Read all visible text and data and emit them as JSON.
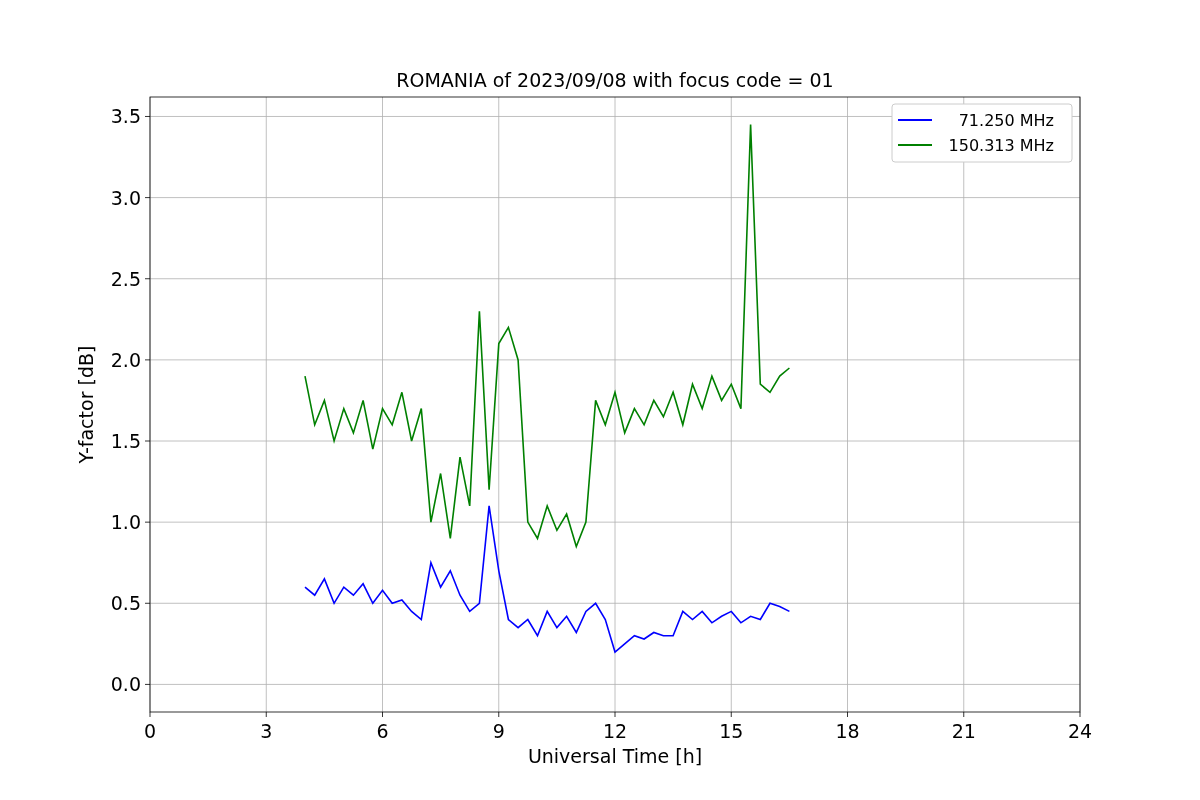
{
  "chart_data": {
    "type": "line",
    "title": "ROMANIA of 2023/09/08 with focus code = 01",
    "xlabel": "Universal Time [h]",
    "ylabel": "Y-factor [dB]",
    "x": [
      4.0,
      4.25,
      4.5,
      4.75,
      5.0,
      5.25,
      5.5,
      5.75,
      6.0,
      6.25,
      6.5,
      6.75,
      7.0,
      7.25,
      7.5,
      7.75,
      8.0,
      8.25,
      8.5,
      8.75,
      9.0,
      9.25,
      9.5,
      9.75,
      10.0,
      10.25,
      10.5,
      10.75,
      11.0,
      11.25,
      11.5,
      11.75,
      12.0,
      12.25,
      12.5,
      12.75,
      13.0,
      13.25,
      13.5,
      13.75,
      14.0,
      14.25,
      14.5,
      14.75,
      15.0,
      15.25,
      15.5,
      15.75,
      16.0,
      16.25,
      16.5
    ],
    "series": [
      {
        "name": "71.250 MHz",
        "color": "#0000ff",
        "values": [
          0.6,
          0.55,
          0.65,
          0.5,
          0.6,
          0.55,
          0.62,
          0.5,
          0.58,
          0.5,
          0.52,
          0.45,
          0.4,
          0.75,
          0.6,
          0.7,
          0.55,
          0.45,
          0.5,
          1.1,
          0.7,
          0.4,
          0.35,
          0.4,
          0.3,
          0.45,
          0.35,
          0.42,
          0.32,
          0.45,
          0.5,
          0.4,
          0.2,
          0.25,
          0.3,
          0.28,
          0.32,
          0.3,
          0.3,
          0.45,
          0.4,
          0.45,
          0.38,
          0.42,
          0.45,
          0.38,
          0.42,
          0.4,
          0.5,
          0.48,
          0.45
        ]
      },
      {
        "name": "150.313 MHz",
        "color": "#008000",
        "values": [
          1.9,
          1.6,
          1.75,
          1.5,
          1.7,
          1.55,
          1.75,
          1.45,
          1.7,
          1.6,
          1.8,
          1.5,
          1.7,
          1.0,
          1.3,
          0.9,
          1.4,
          1.1,
          2.3,
          1.2,
          2.1,
          2.2,
          2.0,
          1.0,
          0.9,
          1.1,
          0.95,
          1.05,
          0.85,
          1.0,
          1.75,
          1.6,
          1.8,
          1.55,
          1.7,
          1.6,
          1.75,
          1.65,
          1.8,
          1.6,
          1.85,
          1.7,
          1.9,
          1.75,
          1.85,
          1.7,
          3.45,
          1.85,
          1.8,
          1.9,
          1.95
        ]
      }
    ],
    "grid": true,
    "legend": true,
    "xlim": [
      0,
      24
    ],
    "ylim": [
      -0.17,
      3.62
    ],
    "xticks": [
      0,
      3,
      6,
      9,
      12,
      15,
      18,
      21,
      24
    ],
    "yticks": [
      {
        "value": 0,
        "label": "0.0"
      },
      {
        "value": 0.5,
        "label": "0.5"
      },
      {
        "value": 1,
        "label": "1.0"
      },
      {
        "value": 1.5,
        "label": "1.5"
      },
      {
        "value": 2,
        "label": "2.0"
      },
      {
        "value": 2.5,
        "label": "2.5"
      },
      {
        "value": 3,
        "label": "3.0"
      },
      {
        "value": 3.5,
        "label": "3.5"
      }
    ]
  }
}
